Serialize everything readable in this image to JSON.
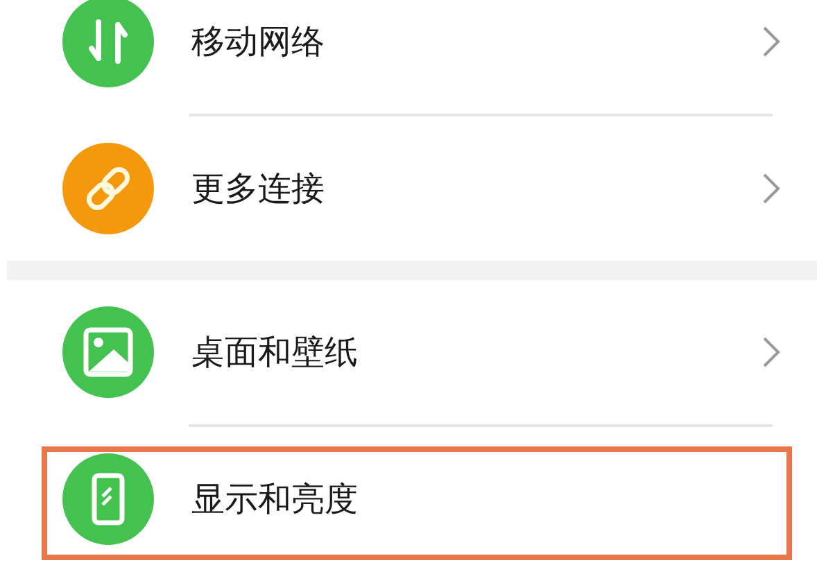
{
  "groups": [
    {
      "items": [
        {
          "kind": "swap",
          "color": "#43c24f",
          "label": "移动网络",
          "chevron": true,
          "highlighted": false
        },
        {
          "kind": "link",
          "color": "#f5980c",
          "label": "更多连接",
          "chevron": true,
          "highlighted": false
        }
      ]
    },
    {
      "items": [
        {
          "kind": "image",
          "color": "#43c24f",
          "label": "桌面和壁纸",
          "chevron": true,
          "highlighted": false
        },
        {
          "kind": "phone",
          "color": "#43c24f",
          "label": "显示和亮度",
          "chevron": false,
          "highlighted": true
        }
      ]
    }
  ]
}
